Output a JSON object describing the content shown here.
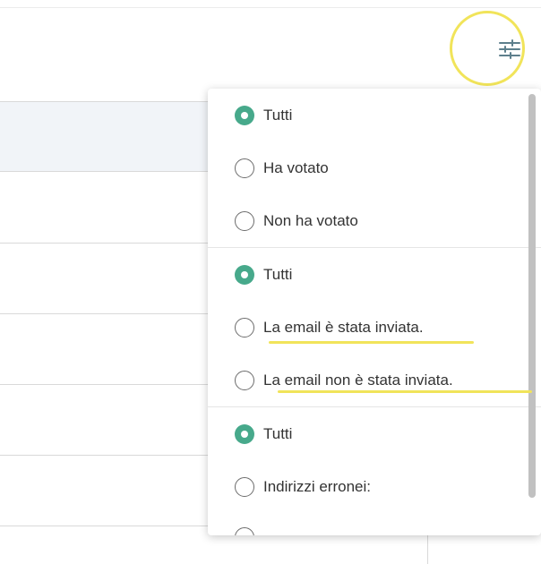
{
  "toolbar": {
    "filter_icon": "sliders-icon"
  },
  "menu": {
    "groups": [
      {
        "options": [
          {
            "label": "Tutti",
            "checked": true
          },
          {
            "label": "Ha votato",
            "checked": false
          },
          {
            "label": "Non ha votato",
            "checked": false
          }
        ]
      },
      {
        "options": [
          {
            "label": "Tutti",
            "checked": true
          },
          {
            "label": "La email è stata inviata.",
            "checked": false
          },
          {
            "label": "La email non è stata inviata.",
            "checked": false
          }
        ]
      },
      {
        "options": [
          {
            "label": "Tutti",
            "checked": true
          },
          {
            "label": "Indirizzi erronei:",
            "checked": false
          }
        ]
      }
    ]
  },
  "colors": {
    "accent": "#47a98b",
    "highlight": "#f1e45a"
  }
}
